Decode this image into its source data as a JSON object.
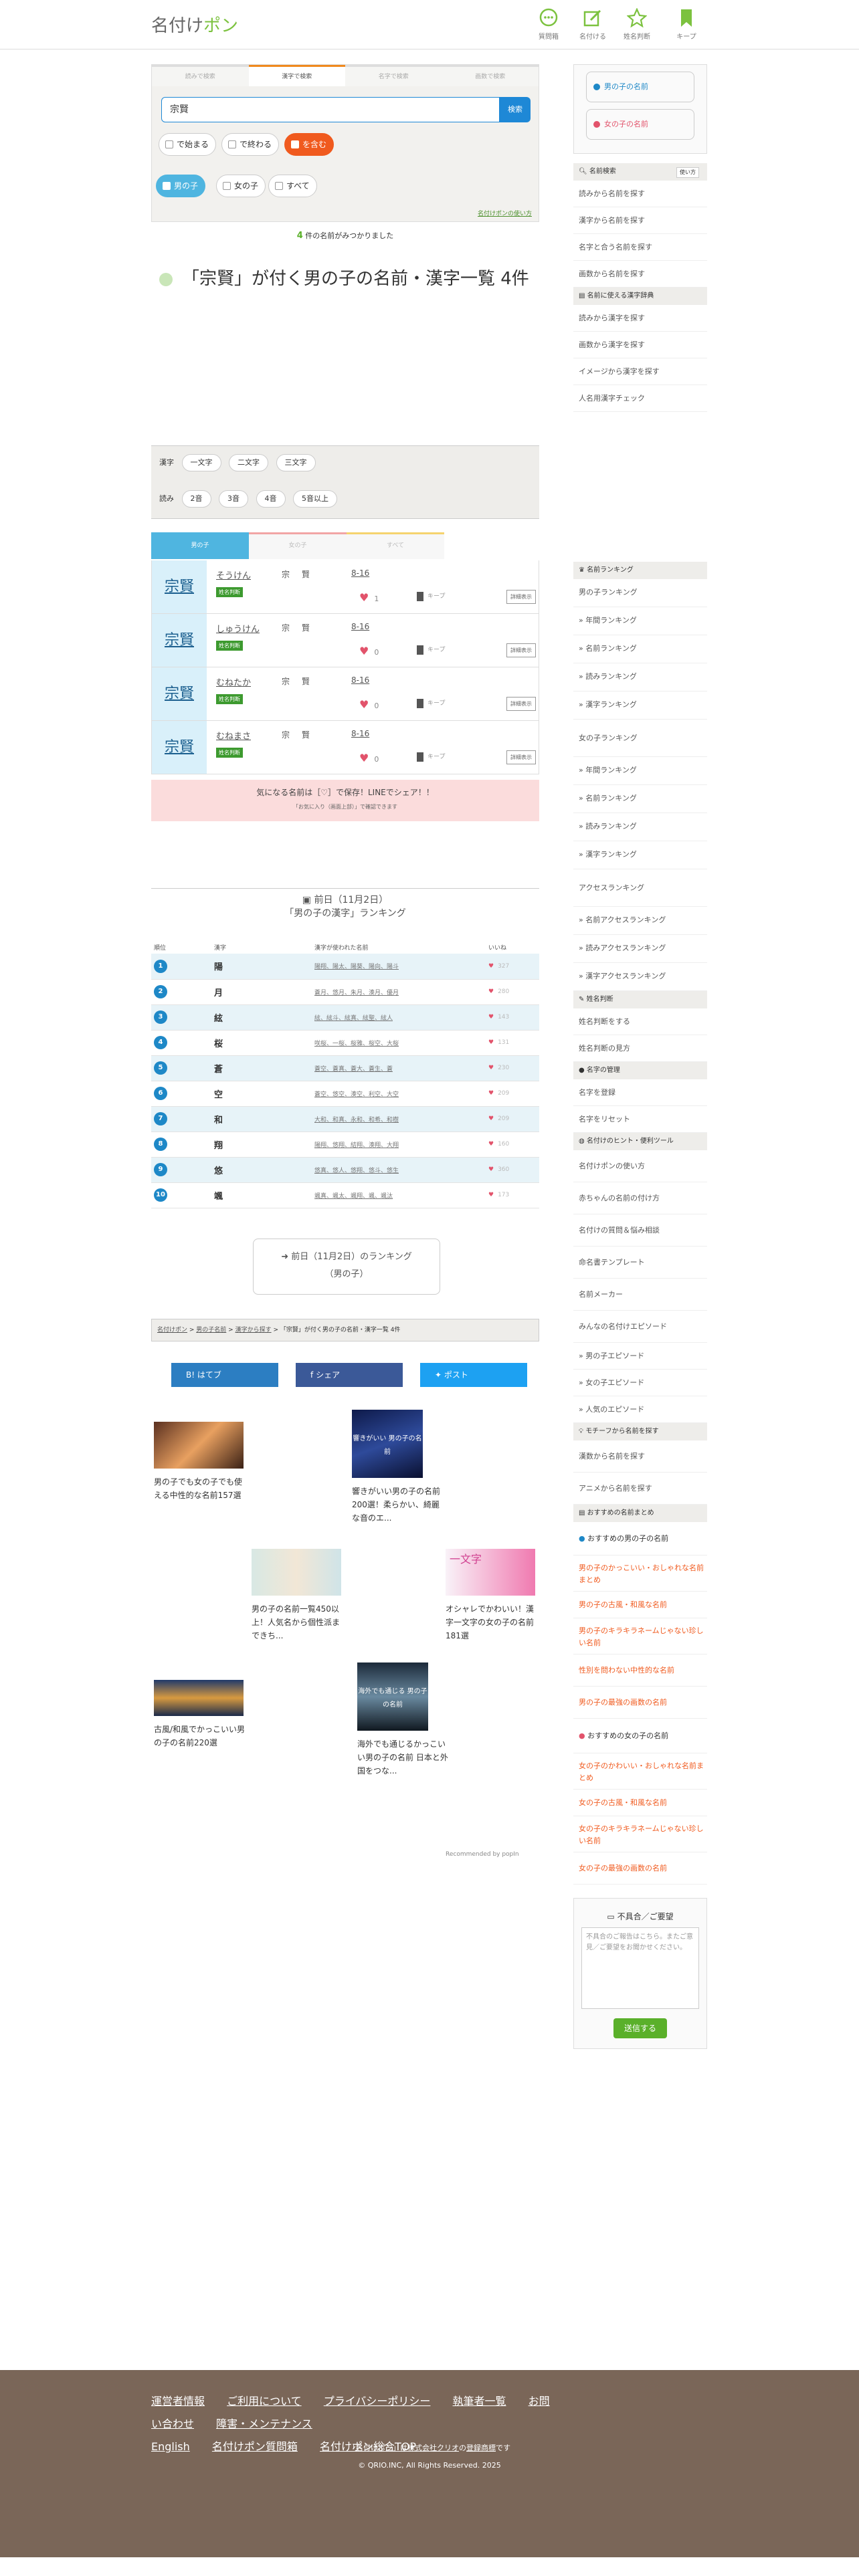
{
  "header": {
    "logo_main": "名付け",
    "logo_accent": "ポン",
    "nav": [
      {
        "label": "質問箱",
        "icon": "chat-bubble-icon"
      },
      {
        "label": "名付ける",
        "icon": "pen-note-icon"
      },
      {
        "label": "姓名判断",
        "icon": "star-icon"
      },
      {
        "label": "キープ",
        "icon": "bookmark-icon"
      }
    ]
  },
  "search": {
    "tabs": [
      "読みで検索",
      "漢字で検索",
      "名字で検索",
      "画数で検索"
    ],
    "query": "宗賢",
    "button": "検索",
    "match_options": [
      "で始まる",
      "で終わる",
      "を含む"
    ],
    "gender_options": [
      "男の子",
      "女の子",
      "すべて"
    ],
    "howto_link": "名付けポンの使い方"
  },
  "result": {
    "count": "4",
    "count_suffix": "件の名前がみつかりました",
    "title": "「宗賢」が付く男の子の名前・漢字一覧 4件"
  },
  "filters": {
    "kanji_label": "漢字",
    "kanji_chips": [
      "一文字",
      "二文字",
      "三文字"
    ],
    "yomi_label": "読み",
    "yomi_chips": [
      "2音",
      "3音",
      "4音",
      "5音以上"
    ]
  },
  "gender_tabs": [
    "男の子",
    "女の子",
    "すべて"
  ],
  "names": [
    {
      "kanji": "宗賢",
      "yomi": "そうけん",
      "badge": "姓名判断",
      "char1": "宗",
      "char2": "賢",
      "strokes": "8-16",
      "likes": "1",
      "keep": "キープ",
      "detail": "詳細表示"
    },
    {
      "kanji": "宗賢",
      "yomi": "しゅうけん",
      "badge": "姓名判断",
      "char1": "宗",
      "char2": "賢",
      "strokes": "8-16",
      "likes": "0",
      "keep": "キープ",
      "detail": "詳細表示"
    },
    {
      "kanji": "宗賢",
      "yomi": "むねたか",
      "badge": "姓名判断",
      "char1": "宗",
      "char2": "賢",
      "strokes": "8-16",
      "likes": "0",
      "keep": "キープ",
      "detail": "詳細表示"
    },
    {
      "kanji": "宗賢",
      "yomi": "むねまさ",
      "badge": "姓名判断",
      "char1": "宗",
      "char2": "賢",
      "strokes": "8-16",
      "likes": "0",
      "keep": "キープ",
      "detail": "詳細表示"
    }
  ],
  "line_box": {
    "text": "気になる名前は［♡］で保存！LINEでシェア！！",
    "sub": "「お気に入り（画面上部）」で確認できます"
  },
  "ranking": {
    "date_line": "前日（11月2日）",
    "title": "「男の子の漢字」ランキング",
    "headers": [
      "順位",
      "漢字",
      "漢字が使われた名前",
      "いいね"
    ],
    "rows": [
      {
        "rank": "1",
        "kanji": "陽",
        "names": "陽翔、陽太、陽葵、陽向、陽斗",
        "likes": "327"
      },
      {
        "rank": "2",
        "kanji": "月",
        "names": "蒼月、悠月、朱月、湊月、優月",
        "likes": "280"
      },
      {
        "rank": "3",
        "kanji": "絃",
        "names": "絃、絃斗、絃真、絃聖、絃人",
        "likes": "143"
      },
      {
        "rank": "4",
        "kanji": "桜",
        "names": "咲桜、一桜、桜雅、桜空、大桜",
        "likes": "131"
      },
      {
        "rank": "5",
        "kanji": "蒼",
        "names": "蒼空、蒼真、蒼大、蒼生、蒼",
        "likes": "230"
      },
      {
        "rank": "6",
        "kanji": "空",
        "names": "蒼空、悠空、湊空、利空、大空",
        "likes": "209"
      },
      {
        "rank": "7",
        "kanji": "和",
        "names": "大和、和真、永和、和希、和樹",
        "likes": "209"
      },
      {
        "rank": "8",
        "kanji": "翔",
        "names": "陽翔、悠翔、結翔、湊翔、大翔",
        "likes": "160"
      },
      {
        "rank": "9",
        "kanji": "悠",
        "names": "悠真、悠人、悠翔、悠斗、悠生",
        "likes": "360"
      },
      {
        "rank": "10",
        "kanji": "颯",
        "names": "颯真、颯太、颯翔、颯、颯汰",
        "likes": "173"
      }
    ],
    "button_line1": "前日（11月2日）のランキング",
    "button_line2": "（男の子）"
  },
  "breadcrumb": [
    "名付けポン",
    "男の子名前",
    "漢字から探す",
    "「宗賢」が付く男の子の名前・漢字一覧 4件"
  ],
  "share": {
    "hatena": "はてブ",
    "facebook": "シェア",
    "x": "ポスト"
  },
  "recommend": [
    {
      "title": "男の子でも女の子でも使える中性的な名前157選"
    },
    {
      "title": "響きがいい男の子の名前200選！柔らかい、綺麗な音のエ...",
      "thumb_text": "響きがいい 男の子の名前"
    },
    {
      "title": "男の子の名前一覧450以上！人気名から個性派まできち..."
    },
    {
      "title": "オシャレでかわいい！漢字一文字の女の子の名前181選",
      "thumb_text": "一文字"
    },
    {
      "title": "古風/和風でかっこいい男の子の名前220選"
    },
    {
      "title": "海外でも通じるかっこいい男の子の名前 日本と外国をつな...",
      "thumb_text": "海外でも通じる 男の子の名前"
    }
  ],
  "powered_by": "Recommended by popIn",
  "sidebar": {
    "gender_buttons": [
      "男の子の名前",
      "女の子の名前"
    ],
    "search_head": "名前検索",
    "search_badge": "使い方",
    "search_items": [
      "読みから名前を探す",
      "漢字から名前を探す",
      "名字と合う名前を探す",
      "画数から名前を探す"
    ],
    "dict_head": "名前に使える漢字辞典",
    "dict_items": [
      "読みから漢字を探す",
      "画数から漢字を探す",
      "イメージから漢字を探す",
      "人名用漢字チェック"
    ],
    "rank_head": "名前ランキング",
    "rank_items": [
      "男の子ランキング",
      "年間ランキング",
      "名前ランキング",
      "読みランキング",
      "漢字ランキング",
      "女の子ランキング",
      "年間ランキング",
      "名前ランキング",
      "読みランキング",
      "漢字ランキング",
      "アクセスランキング",
      "名前アクセスランキング",
      "読みアクセスランキング",
      "漢字アクセスランキング"
    ],
    "seimei_head": "姓名判断",
    "seimei_items": [
      "姓名判断をする",
      "姓名判断の見方"
    ],
    "myoji_head": "名字の管理",
    "myoji_items": [
      "名字を登録",
      "名字をリセット"
    ],
    "tips_head": "名付けのヒント・便利ツール",
    "tips_items": [
      "名付けポンの使い方",
      "赤ちゃんの名前の付け方",
      "名付けの質問＆悩み相談",
      "命名書テンプレート",
      "名前メーカー",
      "みんなの名付けエピソード",
      "男の子エピソード",
      "女の子エピソード",
      "人気のエピソード"
    ],
    "motif_head": "モチーフから名前を探す",
    "motif_items": [
      "漢数から名前を探す",
      "アニメから名前を探す"
    ],
    "matome_head": "おすすめの名前まとめ",
    "matome_boy_head": "おすすめの男の子の名前",
    "matome_boy": [
      "男の子のかっこいい・おしゃれな名前まとめ",
      "男の子の古風・和風な名前",
      "男の子のキラキラネームじゃない珍しい名前",
      "性別を問わない中性的な名前",
      "男の子の最強の画数の名前"
    ],
    "matome_girl_head": "おすすめの女の子の名前",
    "matome_girl": [
      "女の子のかわいい・おしゃれな名前まとめ",
      "女の子の古風・和風な名前",
      "女の子のキラキラネームじゃない珍しい名前",
      "女の子の最強の画数の名前"
    ],
    "feedback_head": "不具合／ご要望",
    "feedback_placeholder": "不具合のご報告はこちら。またご意見／ご要望をお聞かせください。",
    "feedback_button": "送信する"
  },
  "footer": {
    "links": [
      "運営者情報",
      "ご利用について",
      "プライバシーポリシー",
      "執筆者一覧",
      "お問い合わせ",
      "障害・メンテナンス",
      "English",
      "名付けポン質問箱",
      "名付けポン総合TOP"
    ],
    "copy_pre": "「名付けポン」は",
    "copy_link": "株式会社クリオ",
    "copy_mid": "の",
    "copy_link2": "登録商標",
    "copy_post": "です",
    "copyright": "© QRIO.INC, All Rights Reserved. 2025"
  }
}
